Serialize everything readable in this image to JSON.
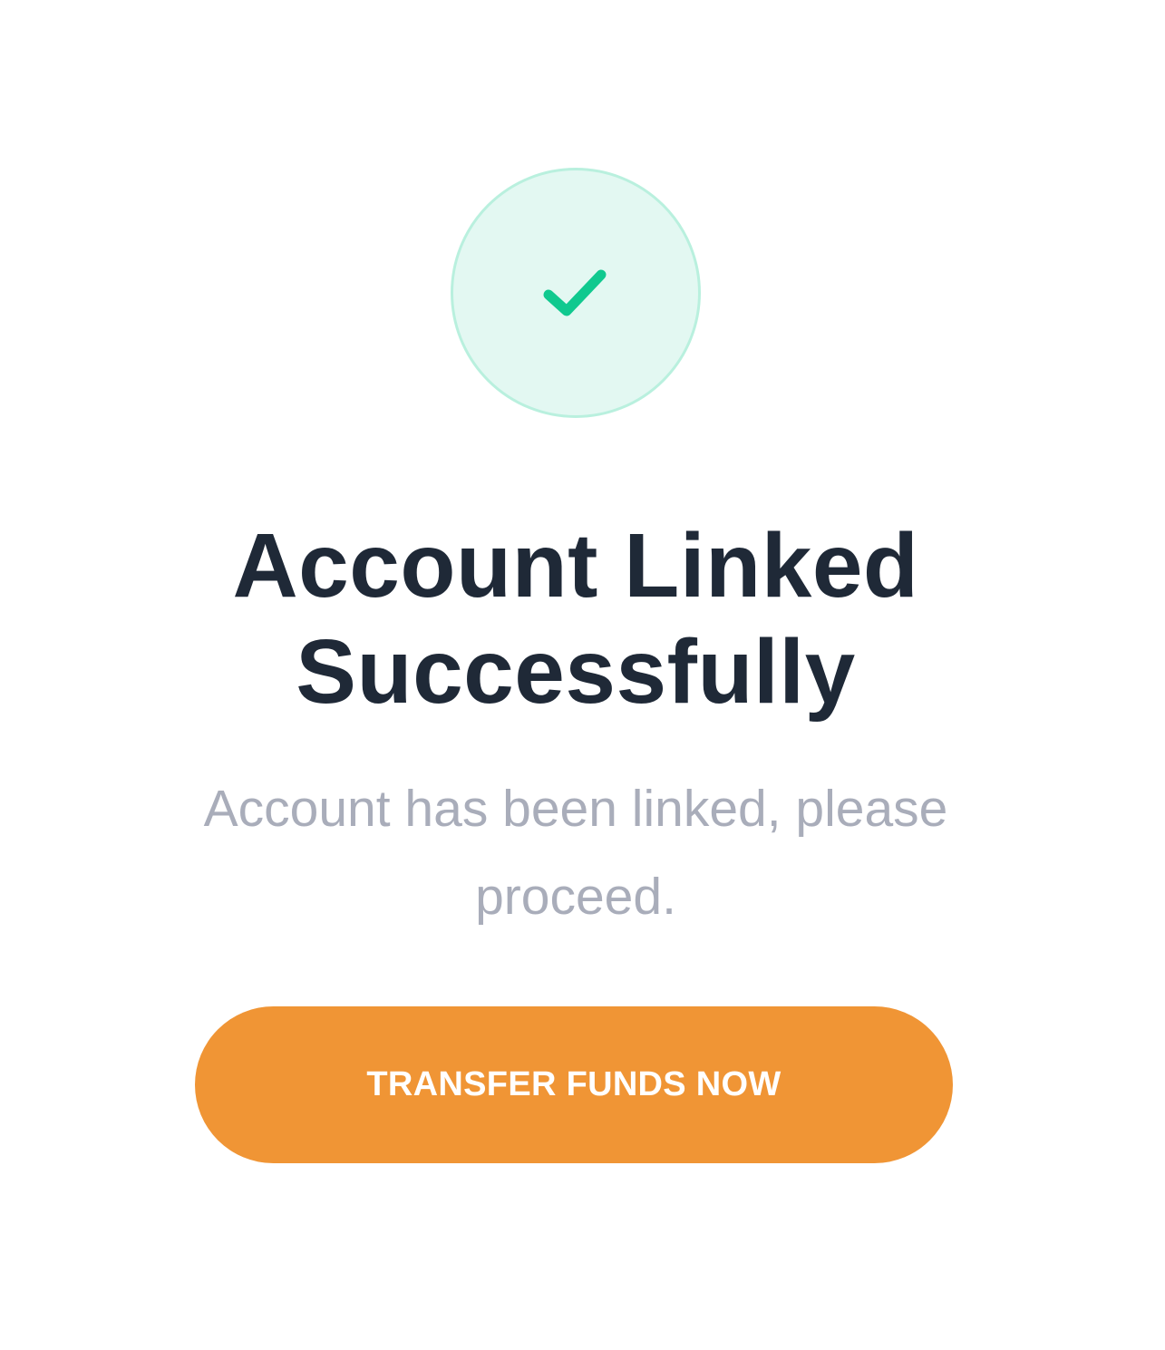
{
  "status": {
    "icon": "check-icon",
    "accent_color": "#10c98f",
    "badge_background": "#e3f8f2"
  },
  "title": {
    "line1": "Account Linked",
    "line2": "Successfully"
  },
  "message": "Account has been linked, please proceed.",
  "action": {
    "label": "TRANSFER FUNDS NOW",
    "color": "#f09535"
  }
}
